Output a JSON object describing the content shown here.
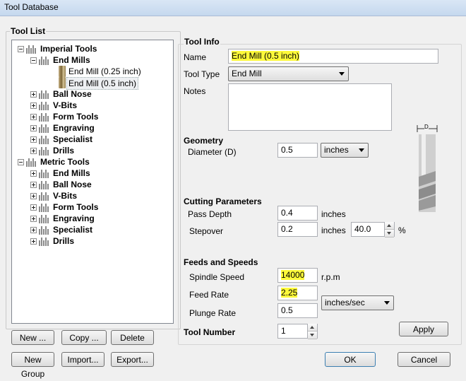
{
  "window": {
    "title": "Tool Database"
  },
  "tool_list": {
    "header": "Tool List",
    "tree": [
      {
        "label": "Imperial Tools",
        "level": 0,
        "expanded": true,
        "bold": true,
        "icon": "folder-icon"
      },
      {
        "label": "End Mills",
        "level": 1,
        "expanded": true,
        "bold": true,
        "icon": "folder-icon"
      },
      {
        "label": "End Mill (0.25 inch)",
        "level": 2,
        "bold": false,
        "icon": "tool-icon"
      },
      {
        "label": "End Mill (0.5 inch)",
        "level": 2,
        "bold": false,
        "icon": "tool-icon",
        "selected": true
      },
      {
        "label": "Ball Nose",
        "level": 1,
        "expanded": false,
        "bold": true,
        "icon": "folder-icon"
      },
      {
        "label": "V-Bits",
        "level": 1,
        "expanded": false,
        "bold": true,
        "icon": "folder-icon"
      },
      {
        "label": "Form Tools",
        "level": 1,
        "expanded": false,
        "bold": true,
        "icon": "folder-icon"
      },
      {
        "label": "Engraving",
        "level": 1,
        "expanded": false,
        "bold": true,
        "icon": "folder-icon"
      },
      {
        "label": "Specialist",
        "level": 1,
        "expanded": false,
        "bold": true,
        "icon": "folder-icon"
      },
      {
        "label": "Drills",
        "level": 1,
        "expanded": false,
        "bold": true,
        "icon": "folder-icon"
      },
      {
        "label": "Metric Tools",
        "level": 0,
        "expanded": true,
        "bold": true,
        "icon": "folder-icon"
      },
      {
        "label": "End Mills",
        "level": 1,
        "expanded": false,
        "bold": true,
        "icon": "folder-icon"
      },
      {
        "label": "Ball Nose",
        "level": 1,
        "expanded": false,
        "bold": true,
        "icon": "folder-icon"
      },
      {
        "label": "V-Bits",
        "level": 1,
        "expanded": false,
        "bold": true,
        "icon": "folder-icon"
      },
      {
        "label": "Form Tools",
        "level": 1,
        "expanded": false,
        "bold": true,
        "icon": "folder-icon"
      },
      {
        "label": "Engraving",
        "level": 1,
        "expanded": false,
        "bold": true,
        "icon": "folder-icon"
      },
      {
        "label": "Specialist",
        "level": 1,
        "expanded": false,
        "bold": true,
        "icon": "folder-icon"
      },
      {
        "label": "Drills",
        "level": 1,
        "expanded": false,
        "bold": true,
        "icon": "folder-icon"
      }
    ],
    "buttons": {
      "new": "New ...",
      "copy": "Copy ...",
      "delete": "Delete",
      "new_group": "New Group",
      "import": "Import...",
      "export": "Export..."
    }
  },
  "tool_info": {
    "header": "Tool Info",
    "name_label": "Name",
    "name_value": "End Mill (0.5 inch)",
    "type_label": "Tool Type",
    "type_value": "End Mill",
    "notes_label": "Notes",
    "notes_value": ""
  },
  "geometry": {
    "header": "Geometry",
    "diameter_label": "Diameter (D)",
    "diameter_value": "0.5",
    "units_value": "inches",
    "diagram_label": "D"
  },
  "cutting": {
    "header": "Cutting Parameters",
    "pass_depth_label": "Pass Depth",
    "pass_depth_value": "0.4",
    "pass_depth_unit": "inches",
    "stepover_label": "Stepover",
    "stepover_value": "0.2",
    "stepover_unit": "inches",
    "stepover_percent": "40.0",
    "percent_sign": "%"
  },
  "feeds": {
    "header": "Feeds and Speeds",
    "spindle_label": "Spindle Speed",
    "spindle_value": "14000",
    "spindle_unit": "r.p.m",
    "feed_label": "Feed Rate",
    "feed_value": "2.25",
    "plunge_label": "Plunge Rate",
    "plunge_value": "0.5",
    "rate_units": "inches/sec"
  },
  "tool_number": {
    "label": "Tool Number",
    "value": "1"
  },
  "buttons": {
    "apply": "Apply",
    "ok": "OK",
    "cancel": "Cancel"
  },
  "colors": {
    "highlight": "#fdf93a"
  }
}
